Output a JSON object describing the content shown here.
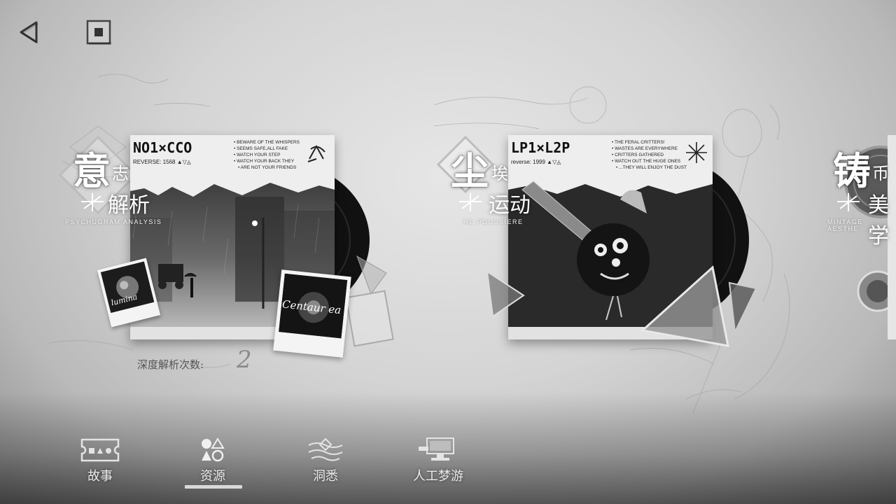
{
  "top_bar": {
    "back_icon": "back-triangle-icon",
    "home_icon": "square-stop-icon"
  },
  "cards": [
    {
      "code": "NO1×CCO",
      "reverse": "REVERSE: 1568",
      "notes": [
        "BEWARE OF THE WHISPERS",
        "SEEMS SAFE,ALL FAKE",
        "WATCH YOUR STEP",
        "WATCH YOUR BACK THEY",
        "ARE NOT YOUR FRIENDS"
      ],
      "title_big": "意",
      "title_small": "志",
      "title_sub": "解析",
      "title_en": "PSYCHUGRAM ANALYSIS",
      "polaroid_left": "lumina",
      "polaroid_right": "Centaur ea"
    },
    {
      "code": "LP1×L2P",
      "reverse": "reverse: 1999",
      "notes": [
        "THE FERAL CRITTERS!",
        "WASTES ARE EVERYWHERE",
        "CRITTERS GATHERED",
        "WATCH OUT THE HUGE ONES",
        "...THEY WILL ENJOY THE DUST"
      ],
      "title_big": "尘",
      "title_small": "埃",
      "title_sub": "运动",
      "title_en": "HE POUSSIERE"
    },
    {
      "title_big": "铸",
      "title_small": "币",
      "title_sub": "美学",
      "title_en": "MINTAGE AESTHE"
    }
  ],
  "deep_analysis": {
    "label": "深度解析次数:",
    "value": "2"
  },
  "bottom_nav": [
    {
      "label": "故事",
      "icon": "ticket-icon",
      "active": false
    },
    {
      "label": "资源",
      "icon": "shapes-icon",
      "active": true
    },
    {
      "label": "洞悉",
      "icon": "diamond-waves-icon",
      "active": false
    },
    {
      "label": "人工梦游",
      "icon": "monitor-icon",
      "active": false
    }
  ]
}
